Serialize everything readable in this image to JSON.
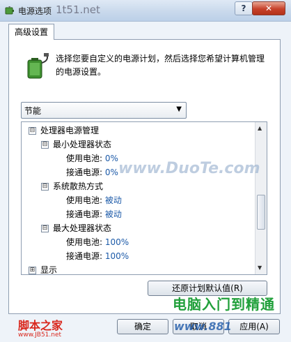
{
  "window": {
    "title": "电源选项",
    "watermark_top": "1t51.net",
    "help": "?",
    "close": "✕"
  },
  "tabs": [
    {
      "label": "高级设置"
    }
  ],
  "description": "选择您要自定义的电源计划，然后选择您希望计算机管理的电源设置。",
  "plan_select": {
    "value": "节能",
    "arrow": "▼"
  },
  "tree": {
    "processor": {
      "label": "处理器电源管理",
      "expander": "⊟"
    },
    "min_state": {
      "label": "最小处理器状态",
      "expander": "⊟",
      "battery_label": "使用电池:",
      "battery_value": "0%",
      "plugged_label": "接通电源:",
      "plugged_value": "0%"
    },
    "cooling": {
      "label": "系统散热方式",
      "expander": "⊟",
      "battery_label": "使用电池:",
      "battery_value": "被动",
      "plugged_label": "接通电源:",
      "plugged_value": "被动"
    },
    "max_state": {
      "label": "最大处理器状态",
      "expander": "⊟",
      "battery_label": "使用电池:",
      "battery_value": "100%",
      "plugged_label": "接通电源:",
      "plugged_value": "100%"
    },
    "display": {
      "label": "显示",
      "expander": "⊞"
    }
  },
  "buttons": {
    "restore": "还原计划默认值(R)",
    "ok": "确定",
    "cancel": "取消",
    "apply": "应用(A)"
  },
  "watermarks": {
    "mid": "www.DuoTe.com",
    "right": "电脑入门到精通",
    "logo_a": "脚本之家",
    "logo_b": "www.JB51.net",
    "bottom": "www.881"
  },
  "icons": {
    "title": "power-options-icon",
    "battery": "battery-plug-icon"
  }
}
